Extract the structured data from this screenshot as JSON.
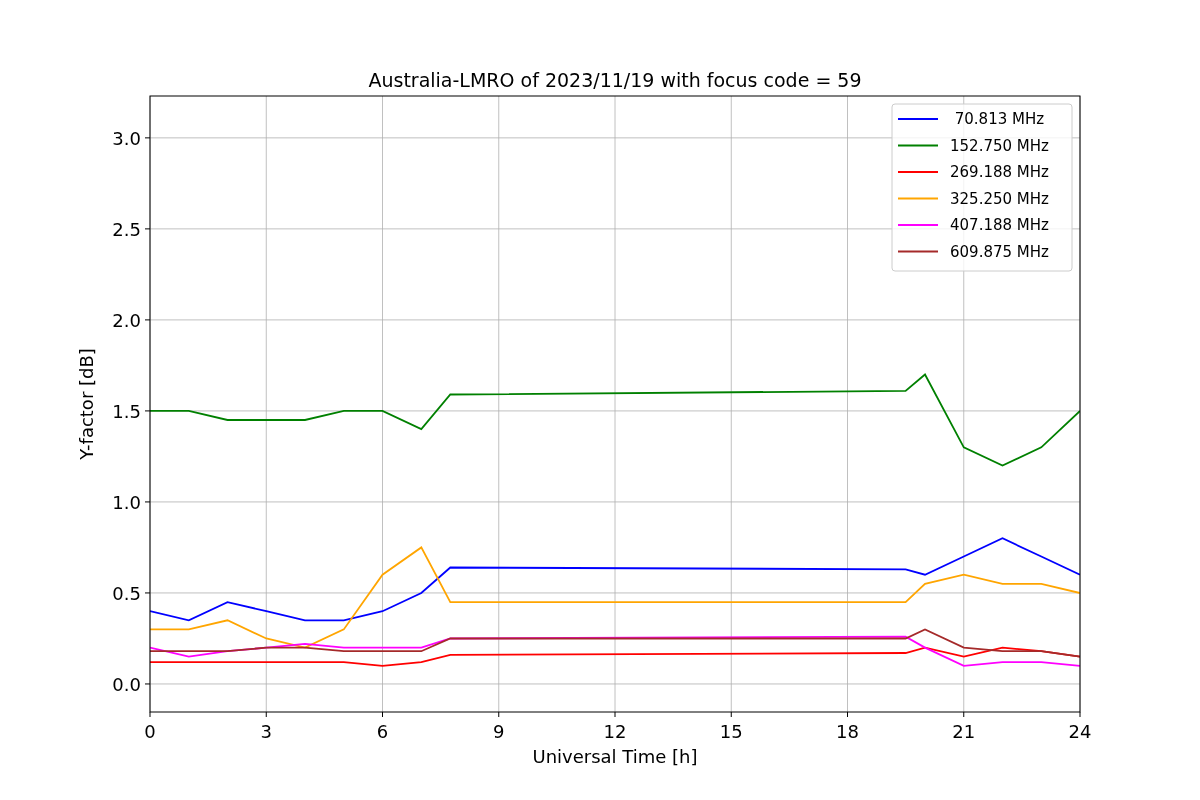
{
  "figure": {
    "chart_data": {
      "type": "line",
      "title": "Australia-LMRO of 2023/11/19 with focus code = 59",
      "xlabel": "Universal Time [h]",
      "ylabel": "Y-factor [dB]",
      "x": [
        0,
        1,
        2,
        3,
        4,
        5,
        6,
        7,
        7.75,
        19.5,
        20,
        21,
        22,
        23,
        24
      ],
      "series": [
        {
          "name": " 70.813 MHz",
          "color": "#0000ff",
          "values": [
            0.4,
            0.35,
            0.45,
            0.4,
            0.35,
            0.35,
            0.4,
            0.5,
            0.64,
            0.63,
            0.6,
            0.7,
            0.8,
            0.7,
            0.6
          ]
        },
        {
          "name": "152.750 MHz",
          "color": "#008000",
          "values": [
            1.5,
            1.5,
            1.45,
            1.45,
            1.45,
            1.5,
            1.5,
            1.4,
            1.59,
            1.61,
            1.7,
            1.3,
            1.2,
            1.3,
            1.5
          ]
        },
        {
          "name": "269.188 MHz",
          "color": "#ff0000",
          "values": [
            0.12,
            0.12,
            0.12,
            0.12,
            0.12,
            0.12,
            0.1,
            0.12,
            0.16,
            0.17,
            0.2,
            0.15,
            0.2,
            0.18,
            0.15
          ]
        },
        {
          "name": "325.250 MHz",
          "color": "#ffa500",
          "values": [
            0.3,
            0.3,
            0.35,
            0.25,
            0.2,
            0.3,
            0.6,
            0.75,
            0.45,
            0.45,
            0.55,
            0.6,
            0.55,
            0.55,
            0.5
          ]
        },
        {
          "name": "407.188 MHz",
          "color": "#ff00ff",
          "values": [
            0.2,
            0.15,
            0.18,
            0.2,
            0.22,
            0.2,
            0.2,
            0.2,
            0.25,
            0.26,
            0.2,
            0.1,
            0.12,
            0.12,
            0.1
          ]
        },
        {
          "name": "609.875 MHz",
          "color": "#a52a2a",
          "values": [
            0.18,
            0.18,
            0.18,
            0.2,
            0.2,
            0.18,
            0.18,
            0.18,
            0.25,
            0.25,
            0.3,
            0.2,
            0.18,
            0.18,
            0.15
          ]
        }
      ],
      "grid": true,
      "legend": true,
      "xlim": [
        0,
        24
      ],
      "ylim": [
        -0.154,
        3.23
      ],
      "xticks": [
        0,
        3,
        6,
        9,
        12,
        15,
        18,
        21,
        24
      ],
      "yticks": [
        {
          "value": 0,
          "label": "0.0"
        },
        {
          "value": 0.5,
          "label": "0.5"
        },
        {
          "value": 1,
          "label": "1.0"
        },
        {
          "value": 1.5,
          "label": "1.5"
        },
        {
          "value": 2,
          "label": "2.0"
        },
        {
          "value": 2.5,
          "label": "2.5"
        },
        {
          "value": 3,
          "label": "3.0"
        }
      ]
    }
  }
}
